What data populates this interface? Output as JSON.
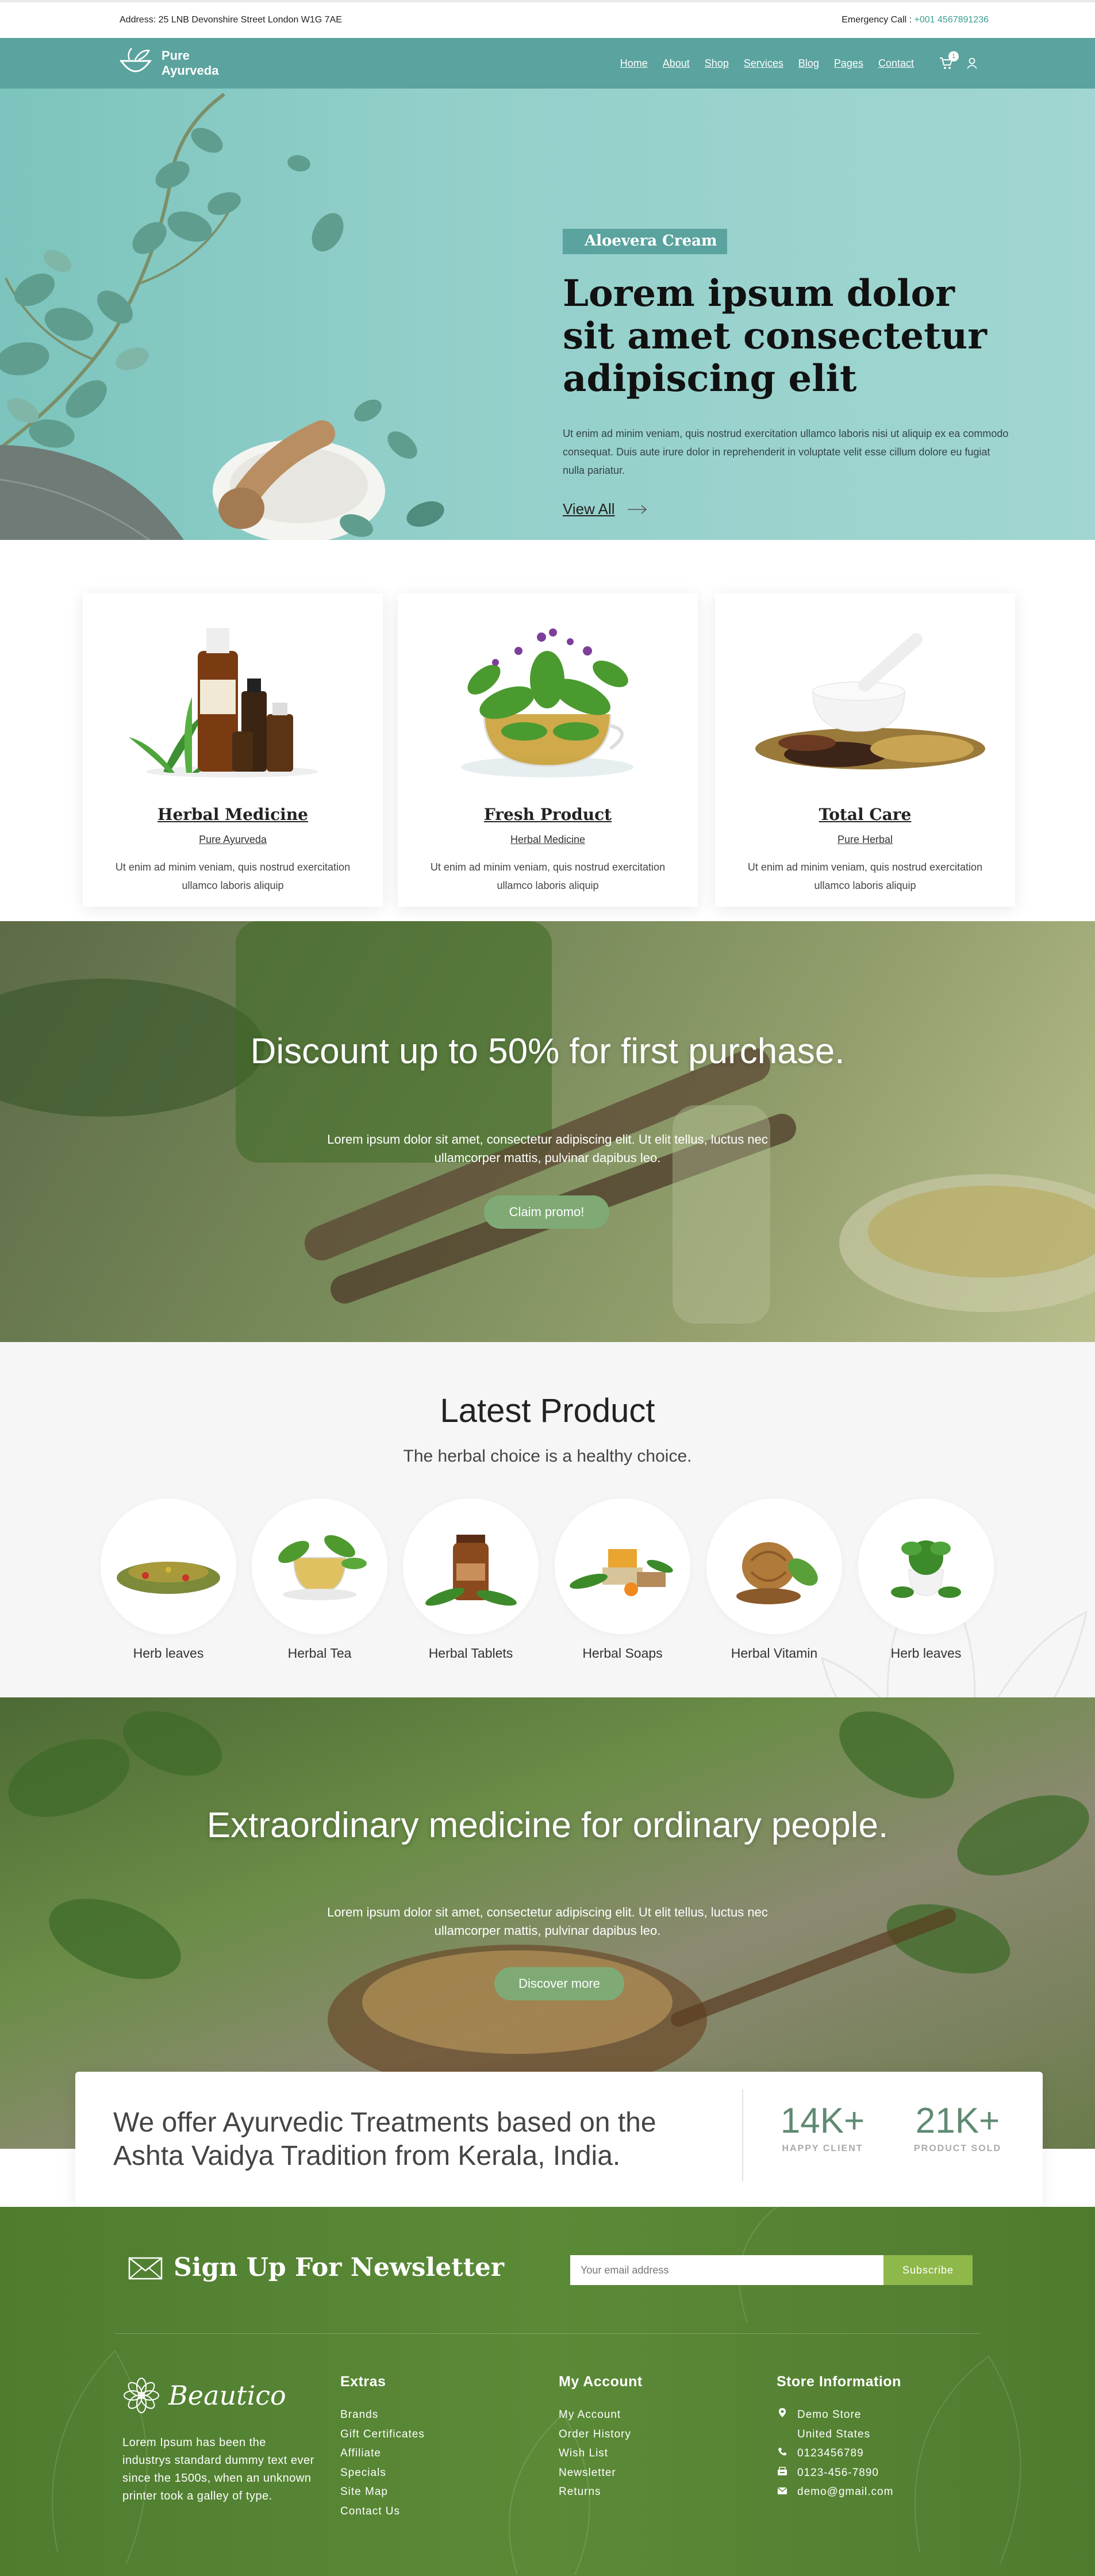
{
  "topbar": {
    "address": "Address: 25 LNB Devonshire Street London W1G 7AE",
    "emergency_label": "Emergency Call :",
    "emergency_phone": "+001 4567891236"
  },
  "nav": {
    "logo_line1": "Pure",
    "logo_line2": "Ayurveda",
    "items": [
      "Home",
      "About",
      "Shop",
      "Services",
      "Blog",
      "Pages",
      "Contact"
    ],
    "cart_count": "1"
  },
  "hero": {
    "tag": "Aloevera Cream",
    "title": "Lorem ipsum dolor sit amet consectetur adipiscing elit",
    "desc": "Ut enim ad minim veniam, quis nostrud exercitation ullamco laboris nisi ut aliquip ex ea commodo consequat. Duis aute irure dolor in reprehenderit in voluptate velit esse cillum dolore eu fugiat nulla pariatur.",
    "link": "View All"
  },
  "features": [
    {
      "title": "Herbal Medicine",
      "sub": "Pure Ayurveda",
      "desc": "Ut enim ad minim veniam, quis nostrud exercitation ullamco laboris aliquip"
    },
    {
      "title": "Fresh Product",
      "sub": "Herbal Medicine",
      "desc": "Ut enim ad minim veniam, quis nostrud exercitation ullamco laboris aliquip"
    },
    {
      "title": "Total Care",
      "sub": "Pure Herbal",
      "desc": "Ut enim ad minim veniam, quis nostrud exercitation ullamco laboris aliquip"
    }
  ],
  "discount": {
    "title": "Discount up to 50% for first purchase.",
    "desc": "Lorem ipsum dolor sit amet, consectetur adipiscing elit. Ut elit tellus, luctus nec ullamcorper mattis, pulvinar dapibus leo.",
    "button": "Claim promo!"
  },
  "latest": {
    "title": "Latest Product",
    "subtitle": "The herbal choice is a healthy choice.",
    "products": [
      "Herb leaves",
      "Herbal Tea",
      "Herbal Tablets",
      "Herbal Soaps",
      "Herbal Vitamin",
      "Herb leaves"
    ]
  },
  "extra": {
    "title": "Extraordinary medicine for ordinary people.",
    "desc": "Lorem ipsum dolor sit amet, consectetur adipiscing elit. Ut elit tellus, luctus nec ullamcorper mattis, pulvinar dapibus leo.",
    "button": "Discover more"
  },
  "stats": {
    "text": "We offer Ayurvedic Treatments based on the Ashta Vaidya Tradition from Kerala, India.",
    "items": [
      {
        "num": "14K+",
        "label": "HAPPY CLIENT"
      },
      {
        "num": "21K+",
        "label": "PRODUCT SOLD"
      }
    ]
  },
  "newsletter": {
    "title": "Sign Up For Newsletter",
    "placeholder": "Your email address",
    "button": "Subscribe"
  },
  "footer": {
    "brand": "Beautico",
    "desc": "Lorem Ipsum has been the industrys standard dummy text ever since the 1500s, when an unknown printer took a galley of type.",
    "extras_title": "Extras",
    "extras": [
      "Brands",
      "Gift Certificates",
      "Affiliate",
      "Specials",
      "Site Map",
      "Contact Us"
    ],
    "account_title": "My Account",
    "account": [
      "My Account",
      "Order History",
      "Wish List",
      "Newsletter",
      "Returns"
    ],
    "store_title": "Store Information",
    "store_name": "Demo Store",
    "store_country": "United States",
    "store_phone": "0123456789",
    "store_fax": "0123-456-7890",
    "store_email": "demo@gmail.com"
  },
  "colors": {
    "teal": "#5aa39e",
    "green_button": "#7faa75",
    "footer_green": "#5b8a37",
    "subscribe": "#8fb84b"
  }
}
